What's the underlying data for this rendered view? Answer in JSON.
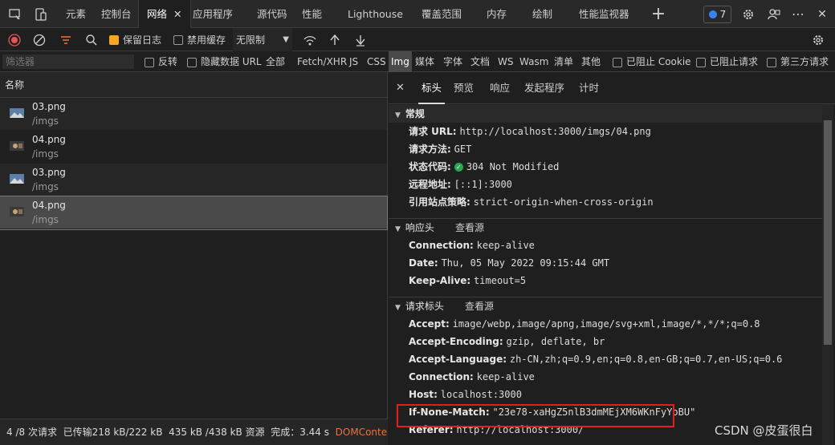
{
  "top_tabs": {
    "elements": "元素",
    "console": "控制台",
    "network": "网络",
    "network_close": "✕",
    "application": "应用程序",
    "sources": "源代码",
    "performance": "性能",
    "lighthouse": "Lighthouse",
    "coverage": "覆盖范围",
    "memory": "内存",
    "rendering": "绘制",
    "perf_monitor": "性能监视器",
    "issues_count": "7"
  },
  "toolbar": {
    "preserve_log": "保留日志",
    "preserve_log_checked": true,
    "disable_cache": "禁用缓存",
    "disable_cache_checked": false,
    "throttle": "无限制"
  },
  "filter": {
    "placeholder": "筛选器",
    "invert": "反转",
    "hide_data_url": "隐藏数据 URL",
    "all": "全部",
    "types": [
      "Fetch/XHR",
      "JS",
      "CSS",
      "Img",
      "媒体",
      "字体",
      "文档",
      "WS",
      "Wasm",
      "清单",
      "其他"
    ],
    "active_type": "Img",
    "blocked_cookies": "已阻止 Cookie",
    "blocked_requests": "已阻止请求",
    "third_party": "第三方请求"
  },
  "request_list": {
    "column_name": "名称",
    "items": [
      {
        "name": "03.png",
        "path": "/imgs"
      },
      {
        "name": "04.png",
        "path": "/imgs"
      },
      {
        "name": "03.png",
        "path": "/imgs"
      },
      {
        "name": "04.png",
        "path": "/imgs"
      }
    ],
    "selected_index": 3
  },
  "status_bar": {
    "requests": "4 /8 次请求",
    "transferred": "已传输218 kB/222 kB",
    "resources": "435 kB /438 kB 资源",
    "finish": "完成：3.44 s",
    "dcl": "DOMContentLoaded"
  },
  "detail_tabs": {
    "close": "✕",
    "headers": "标头",
    "preview": "预览",
    "response": "响应",
    "initiator": "发起程序",
    "timing": "计时"
  },
  "general": {
    "title": "常规",
    "rows": [
      {
        "key": "请求 URL:",
        "value": "http://localhost:3000/imgs/04.png"
      },
      {
        "key": "请求方法:",
        "value": "GET"
      },
      {
        "key": "状态代码:",
        "value": "304 Not Modified"
      },
      {
        "key": "远程地址:",
        "value": "[::1]:3000"
      },
      {
        "key": "引用站点策略:",
        "value": "strict-origin-when-cross-origin"
      }
    ]
  },
  "response_headers": {
    "title": "响应头",
    "view_source": "查看源",
    "rows": [
      {
        "key": "Connection:",
        "value": "keep-alive"
      },
      {
        "key": "Date:",
        "value": "Thu, 05 May 2022 09:15:44 GMT"
      },
      {
        "key": "Keep-Alive:",
        "value": "timeout=5"
      }
    ]
  },
  "request_headers": {
    "title": "请求标头",
    "view_source": "查看源",
    "rows": [
      {
        "key": "Accept:",
        "value": "image/webp,image/apng,image/svg+xml,image/*,*/*;q=0.8"
      },
      {
        "key": "Accept-Encoding:",
        "value": "gzip, deflate, br"
      },
      {
        "key": "Accept-Language:",
        "value": "zh-CN,zh;q=0.9,en;q=0.8,en-GB;q=0.7,en-US;q=0.6"
      },
      {
        "key": "Connection:",
        "value": "keep-alive"
      },
      {
        "key": "Host:",
        "value": "localhost:3000"
      },
      {
        "key": "If-None-Match:",
        "value": "\"23e78-xaHgZ5nlB3dmMEjXM6WKnFyYoBU\""
      },
      {
        "key": "Referer:",
        "value": "http://localhost:3000/"
      }
    ]
  },
  "watermark": "CSDN @皮蛋很白",
  "colors": {
    "accent_checkbox": "#f5a623",
    "highlight_box": "#e02020",
    "status_ok": "#2da44e",
    "dcl": "#e8743b"
  }
}
